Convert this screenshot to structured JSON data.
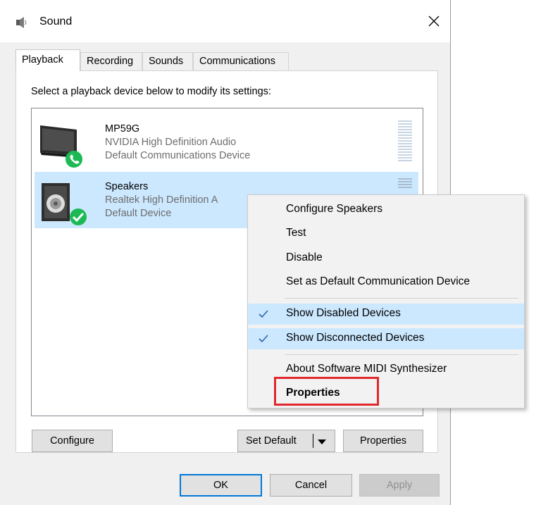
{
  "window": {
    "title": "Sound",
    "icon": "speaker-icon",
    "close_glyph": "✕"
  },
  "tabs": [
    {
      "label": "Playback",
      "active": true
    },
    {
      "label": "Recording",
      "active": false
    },
    {
      "label": "Sounds",
      "active": false
    },
    {
      "label": "Communications",
      "active": false
    }
  ],
  "playback": {
    "instructions": "Select a playback device below to modify its settings:",
    "devices": [
      {
        "name": "MP59G",
        "driver": "NVIDIA High Definition Audio",
        "status": "Default Communications Device",
        "icon": "monitor-icon",
        "badge": "phone-badge-icon",
        "selected": false
      },
      {
        "name": "Speakers",
        "driver": "Realtek High Definition A",
        "status": "Default Device",
        "icon": "speaker-box-icon",
        "badge": "check-badge-icon",
        "selected": true
      }
    ],
    "buttons": {
      "configure": "Configure",
      "set_default": "Set Default",
      "properties": "Properties"
    }
  },
  "context_menu": {
    "items": [
      {
        "label": "Configure Speakers",
        "checked": false,
        "bold": false
      },
      {
        "label": "Test",
        "checked": false,
        "bold": false
      },
      {
        "label": "Disable",
        "checked": false,
        "bold": false
      },
      {
        "label": "Set as Default Communication Device",
        "checked": false,
        "bold": false
      },
      {
        "label": "Show Disabled Devices",
        "checked": true,
        "bold": false
      },
      {
        "label": "Show Disconnected Devices",
        "checked": true,
        "bold": false
      },
      {
        "label": "About Software MIDI Synthesizer",
        "checked": false,
        "bold": false
      },
      {
        "label": "Properties",
        "checked": false,
        "bold": true,
        "highlighted": true
      }
    ]
  },
  "footer": {
    "ok": "OK",
    "cancel": "Cancel",
    "apply": "Apply"
  },
  "colors": {
    "selection": "#cce8ff",
    "accent": "#0078d7",
    "highlight_box": "#e0282e",
    "badge_green": "#1db954"
  }
}
